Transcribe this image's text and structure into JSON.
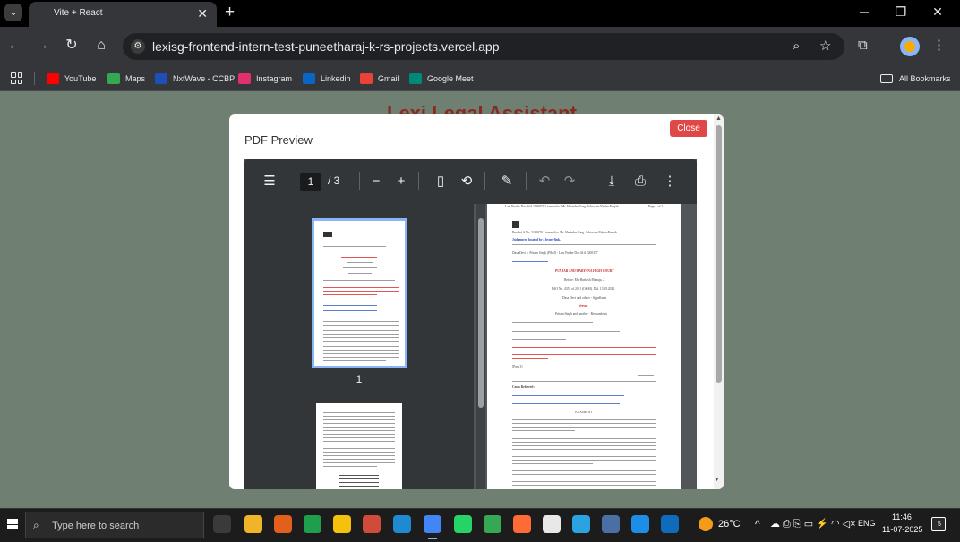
{
  "browser": {
    "tab_title": "Vite + React",
    "url": "lexisg-frontend-intern-test-puneetharaj-k-rs-projects.vercel.app",
    "bookmarks": [
      {
        "label": "YouTube",
        "color": "#ff0000"
      },
      {
        "label": "Maps",
        "color": "#34a853"
      },
      {
        "label": "NxtWave - CCBP",
        "color": "#1e4fb8"
      },
      {
        "label": "Instagram",
        "color": "#e1306c"
      },
      {
        "label": "Linkedin",
        "color": "#0a66c2"
      },
      {
        "label": "Gmail",
        "color": "#ea4335"
      },
      {
        "label": "Google Meet",
        "color": "#00897b"
      }
    ],
    "all_bookmarks": "All Bookmarks"
  },
  "page": {
    "background_title": "Lexi Legal Assistant",
    "modal": {
      "title": "PDF Preview",
      "close_label": "Close"
    },
    "viewer": {
      "current_page": "1",
      "total_pages": "/ 3",
      "thumb_label": "1"
    },
    "document": {
      "header": "Law Finder Doc Id # 2066970 Licensed to: Mr. Harinder Garg, Advocate Nabha-Punjab",
      "page_no": "Page 1 of 1",
      "product": "Product S.No. 2166970 Licensed to: Mr. Harinder Garg, Advocate Nabha-Punjab",
      "hyperlink_note": "Judgement located by a hyper-link.",
      "case_line": "Dasa Devi v. Pritam Singh (P&H) - Law Finder Doc Id # 2200337",
      "court": "PUNJAB AND HARYANA HIGH COURT",
      "before": "Before: Mr. Harkesh Manuja, J.",
      "fao": "FAO No. 4353 of 2011 (O&M). Dtd. 13.09.2022.",
      "parties1": "Dasa Devi and others - Appellants",
      "versus": "Versus",
      "parties2": "Pritam Singh and another - Respondents",
      "heading_note": "Motor Vehicles Act, 1988, Section 166 - Compensation - Future prospects - Held that as the age of the deceased at the time of accident was held to be about 51-52 years, being self-employed, as such, 30% of annual income should have been awarded on account of future prospects.",
      "para": "[Para 3]",
      "cases_referred": "Cases Referred :",
      "judgment": "JUDGMENT"
    }
  },
  "taskbar": {
    "search_placeholder": "Type here to search",
    "weather": "26°C",
    "language": "ENG",
    "time": "11:46",
    "date": "11-07-2025",
    "notification_count": "5"
  }
}
